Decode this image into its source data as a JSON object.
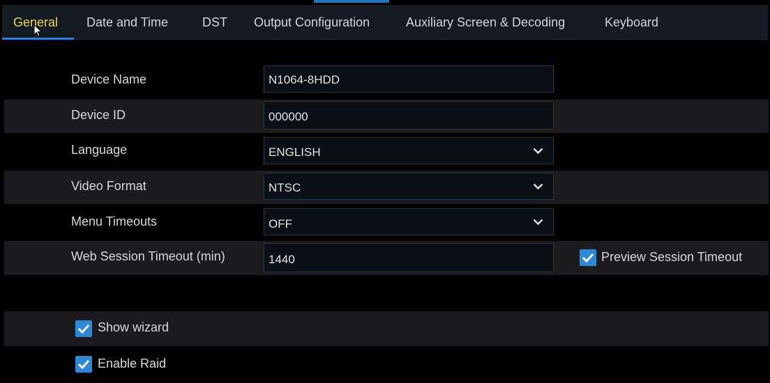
{
  "tabs": [
    {
      "label": "General",
      "active": true
    },
    {
      "label": "Date and Time",
      "active": false
    },
    {
      "label": "DST",
      "active": false
    },
    {
      "label": "Output Configuration",
      "active": false
    },
    {
      "label": "Auxiliary Screen & Decoding",
      "active": false
    },
    {
      "label": "Keyboard",
      "active": false
    }
  ],
  "form": {
    "device_name": {
      "label": "Device Name",
      "value": "N1064-8HDD"
    },
    "device_id": {
      "label": "Device ID",
      "value": "000000"
    },
    "language": {
      "label": "Language",
      "value": "ENGLISH"
    },
    "video_format": {
      "label": "Video Format",
      "value": "NTSC"
    },
    "menu_timeouts": {
      "label": "Menu Timeouts",
      "value": "OFF"
    },
    "web_session_timeout": {
      "label": "Web Session Timeout (min)",
      "value": "1440"
    }
  },
  "options": {
    "preview_session_timeout": {
      "label": "Preview Session Timeout",
      "checked": true
    },
    "show_wizard": {
      "label": "Show wizard",
      "checked": true
    },
    "enable_raid": {
      "label": "Enable Raid",
      "checked": true
    }
  },
  "colors": {
    "accent": "#2e88d8",
    "active_tab_text": "#e9d650",
    "background": "#000000"
  },
  "icons": {
    "dropdown": "chevron-down-icon",
    "checkbox": "checkmark-icon",
    "pointer": "mouse-cursor-icon"
  }
}
